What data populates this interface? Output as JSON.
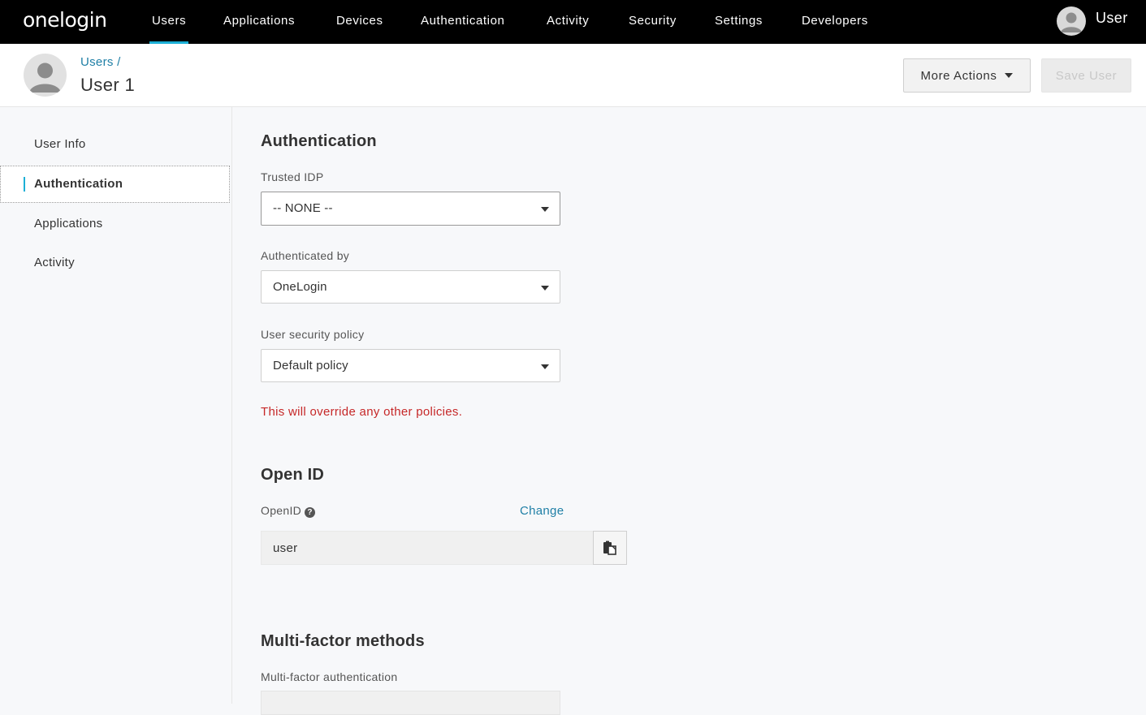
{
  "brand": {
    "logo_text": "onelogin",
    "accent": "#1cafd6"
  },
  "topnav": {
    "items": [
      {
        "label": "Users",
        "active": true
      },
      {
        "label": "Applications"
      },
      {
        "label": "Devices"
      },
      {
        "label": "Authentication"
      },
      {
        "label": "Activity"
      },
      {
        "label": "Security"
      },
      {
        "label": "Settings"
      },
      {
        "label": "Developers"
      }
    ],
    "user_label": "User"
  },
  "header": {
    "breadcrumb": "Users /",
    "title": "User 1",
    "more_actions_label": "More Actions",
    "save_label": "Save User"
  },
  "sidebar": {
    "items": [
      {
        "label": "User Info"
      },
      {
        "label": "Authentication",
        "active": true
      },
      {
        "label": "Applications"
      },
      {
        "label": "Activity"
      }
    ]
  },
  "authentication": {
    "title": "Authentication",
    "trusted_idp": {
      "label": "Trusted IDP",
      "value": "-- NONE --"
    },
    "authenticated_by": {
      "label": "Authenticated by",
      "value": "OneLogin"
    },
    "security_policy": {
      "label": "User security policy",
      "value": "Default policy"
    },
    "warning": "This will override any other policies.",
    "warning_color": "#c62828"
  },
  "openid": {
    "title": "Open ID",
    "label": "OpenID",
    "help_glyph": "?",
    "change_label": "Change",
    "value": "user"
  },
  "mfa": {
    "title": "Multi-factor methods",
    "label": "Multi-factor authentication"
  },
  "icons": {
    "help": "question-circle-icon",
    "copy": "clipboard-icon",
    "avatar": "user-avatar-icon",
    "dropdown": "caret-down-icon"
  }
}
